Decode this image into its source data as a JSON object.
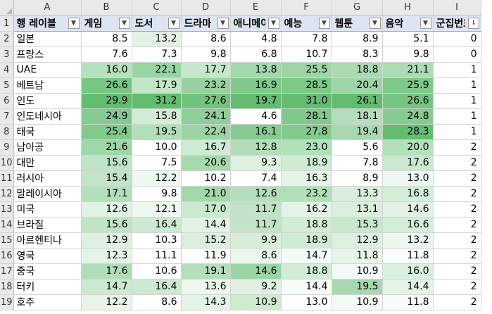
{
  "columns": [
    "A",
    "B",
    "C",
    "D",
    "E",
    "F",
    "G",
    "H",
    "I"
  ],
  "header": {
    "row_number": "1",
    "cells": [
      "행 레이블",
      "게임",
      "도서",
      "드라마",
      "애니메이션",
      "예능",
      "웹툰",
      "음악",
      "군집번호"
    ]
  },
  "rows": [
    {
      "n": "2",
      "name": "일본",
      "vals": [
        "8.5",
        "13.2",
        "8.6",
        "4.8",
        "7.8",
        "8.9",
        "5.1"
      ],
      "bg": [
        "#ffffff",
        "#e4f2e6",
        "#ffffff",
        "#ffffff",
        "#ffffff",
        "#ffffff",
        "#ffffff"
      ],
      "cluster": "0"
    },
    {
      "n": "3",
      "name": "프랑스",
      "vals": [
        "7.6",
        "7.3",
        "9.8",
        "6.8",
        "10.7",
        "8.3",
        "9.8"
      ],
      "bg": [
        "#ffffff",
        "#ffffff",
        "#ffffff",
        "#ffffff",
        "#ffffff",
        "#ffffff",
        "#ffffff"
      ],
      "cluster": "0"
    },
    {
      "n": "4",
      "name": "UAE",
      "vals": [
        "16.0",
        "22.1",
        "17.7",
        "13.8",
        "25.5",
        "18.8",
        "21.1"
      ],
      "bg": [
        "#b7e1be",
        "#99d4a3",
        "#c7e7cc",
        "#a3d8ac",
        "#9dd5a6",
        "#add9b4",
        "#abdcb3"
      ],
      "cluster": "1",
      "sep": true
    },
    {
      "n": "5",
      "name": "베트남",
      "vals": [
        "26.6",
        "17.9",
        "23.2",
        "16.9",
        "28.5",
        "20.4",
        "25.9"
      ],
      "bg": [
        "#78c584",
        "#c3e6c9",
        "#97d1a0",
        "#7fc98a",
        "#7cc887",
        "#9fd4a8",
        "#7ec989"
      ],
      "cluster": "1"
    },
    {
      "n": "6",
      "name": "인도",
      "vals": [
        "29.9",
        "31.2",
        "27.6",
        "19.7",
        "31.0",
        "26.1",
        "26.6"
      ],
      "bg": [
        "#63bc70",
        "#63bc70",
        "#73c27e",
        "#63bc70",
        "#63bc70",
        "#63bc70",
        "#76c481"
      ],
      "cluster": "1"
    },
    {
      "n": "7",
      "name": "인도네시아",
      "vals": [
        "24.9",
        "15.8",
        "24.1",
        "4.6",
        "28.1",
        "18.1",
        "24.8"
      ],
      "bg": [
        "#85ca90",
        "#d3ecd7",
        "#8fcd99",
        "#ffffff",
        "#80c98b",
        "#b5ddbb",
        "#87cb91"
      ],
      "cluster": "1"
    },
    {
      "n": "8",
      "name": "태국",
      "vals": [
        "25.4",
        "19.5",
        "22.4",
        "16.1",
        "27.8",
        "19.4",
        "28.3"
      ],
      "bg": [
        "#82c98d",
        "#b2dfb9",
        "#9cd4a5",
        "#88cb92",
        "#83ca8e",
        "#a9d8b0",
        "#63bc70"
      ],
      "cluster": "1"
    },
    {
      "n": "9",
      "name": "남아공",
      "vals": [
        "21.6",
        "10.0",
        "16.7",
        "12.8",
        "23.0",
        "5.6",
        "20.0"
      ],
      "bg": [
        "#a0d6a9",
        "#ffffff",
        "#d0ebd4",
        "#b3dcb9",
        "#b3e0ba",
        "#ffffff",
        "#b5e0bc"
      ],
      "cluster": "2",
      "sep": true
    },
    {
      "n": "10",
      "name": "대만",
      "vals": [
        "15.6",
        "7.5",
        "20.6",
        "9.3",
        "18.9",
        "7.8",
        "17.6"
      ],
      "bg": [
        "#c0e4c6",
        "#ffffff",
        "#a7d9af",
        "#dff0e2",
        "#d0ecd5",
        "#ffffff",
        "#cbe9d0"
      ],
      "cluster": "2"
    },
    {
      "n": "11",
      "name": "러시아",
      "vals": [
        "15.4",
        "12.2",
        "10.2",
        "7.4",
        "16.3",
        "8.9",
        "13.0"
      ],
      "bg": [
        "#c2e5c8",
        "#eef8f0",
        "#ffffff",
        "#ffffff",
        "#e4f4e7",
        "#ffffff",
        "#eef8f0"
      ],
      "cluster": "2"
    },
    {
      "n": "12",
      "name": "말레이시아",
      "vals": [
        "17.1",
        "9.8",
        "21.0",
        "12.6",
        "23.2",
        "13.3",
        "16.8"
      ],
      "bg": [
        "#b4dfbb",
        "#ffffff",
        "#a3d8ac",
        "#b5ddbb",
        "#b1dfb8",
        "#d9eedc",
        "#d4edd8"
      ],
      "cluster": "2"
    },
    {
      "n": "13",
      "name": "미국",
      "vals": [
        "12.6",
        "12.1",
        "17.0",
        "11.7",
        "16.2",
        "13.1",
        "14.6"
      ],
      "bg": [
        "#e2f2e5",
        "#eef8f0",
        "#cbe9d0",
        "#c3e3c8",
        "#e5f4e8",
        "#dbefde",
        "#e1f2e4"
      ],
      "cluster": "2"
    },
    {
      "n": "14",
      "name": "브라질",
      "vals": [
        "15.6",
        "16.4",
        "14.4",
        "11.7",
        "18.8",
        "15.3",
        "16.6"
      ],
      "bg": [
        "#c0e4c6",
        "#cde9d1",
        "#e2f2e5",
        "#c3e3c8",
        "#d2ecd6",
        "#c9e7ce",
        "#d5eed9"
      ],
      "cluster": "2"
    },
    {
      "n": "15",
      "name": "아르헨티나",
      "vals": [
        "12.9",
        "10.3",
        "15.2",
        "9.9",
        "18.9",
        "12.9",
        "13.2"
      ],
      "bg": [
        "#dff0e2",
        "#ffffff",
        "#dbefde",
        "#d8edda",
        "#d0ecd5",
        "#ddf0e0",
        "#ecf7ee"
      ],
      "cluster": "2"
    },
    {
      "n": "16",
      "name": "영국",
      "vals": [
        "12.3",
        "11.1",
        "11.9",
        "8.6",
        "14.7",
        "11.8",
        "11.8"
      ],
      "bg": [
        "#e5f4e8",
        "#ffffff",
        "#fbfefb",
        "#ebf6ed",
        "#f5fbf6",
        "#e8f5ea",
        "#f9fdf9"
      ],
      "cluster": "2"
    },
    {
      "n": "17",
      "name": "중국",
      "vals": [
        "17.6",
        "10.6",
        "19.1",
        "14.6",
        "18.8",
        "10.9",
        "16.0"
      ],
      "bg": [
        "#b0ddb7",
        "#ffffff",
        "#b6ddbc",
        "#9cd4a5",
        "#d2ecd6",
        "#f4faf5",
        "#dbefde"
      ],
      "cluster": "2"
    },
    {
      "n": "18",
      "name": "터키",
      "vals": [
        "14.7",
        "16.4",
        "13.6",
        "9.2",
        "14.4",
        "19.5",
        "14.4"
      ],
      "bg": [
        "#cce9d1",
        "#cde9d1",
        "#ecf7ee",
        "#e0f1e3",
        "#f7fcf8",
        "#a8d8af",
        "#e3f3e6"
      ],
      "cluster": "2"
    },
    {
      "n": "19",
      "name": "호주",
      "vals": [
        "12.2",
        "8.6",
        "14.3",
        "10.9",
        "13.0",
        "10.9",
        "11.8"
      ],
      "bg": [
        "#e7f5ea",
        "#ffffff",
        "#e4f3e7",
        "#cfeacf",
        "#ffffff",
        "#f4faf5",
        "#f9fdf9"
      ],
      "cluster": "2"
    }
  ],
  "filter_icon": "dropdown-arrow-icon",
  "sort_filter_icon": "filter-sort-icon"
}
